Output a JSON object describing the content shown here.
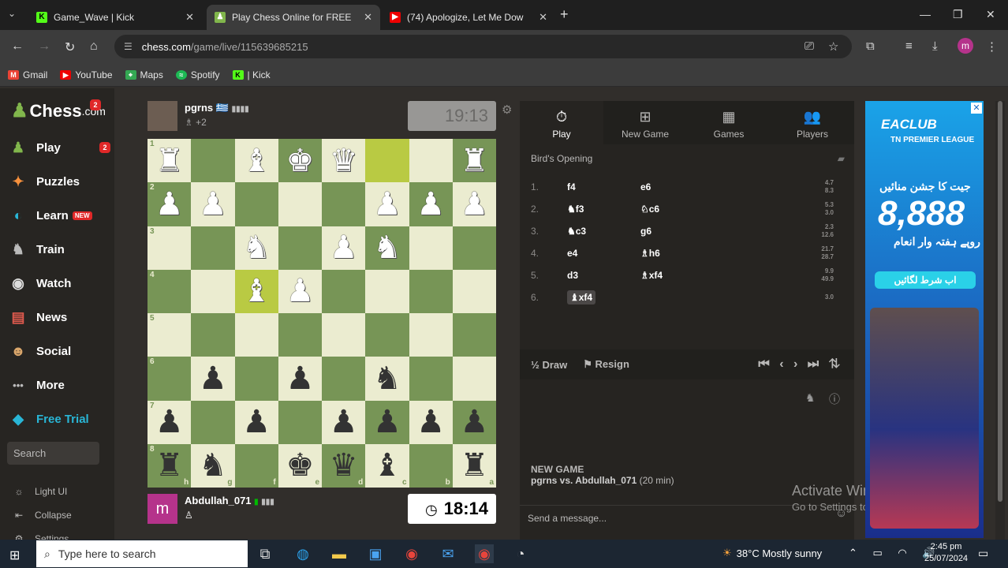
{
  "browser": {
    "tabs": [
      {
        "title": "Game_Wave | Kick",
        "icon": "K"
      },
      {
        "title": "Play Chess Online for FREE",
        "icon": "♟"
      },
      {
        "title": "(74) Apologize, Let Me Dow",
        "icon": "▶"
      }
    ],
    "url_host": "chess.com",
    "url_path": "/game/live/115639685215",
    "bookmarks": [
      "Gmail",
      "YouTube",
      "Maps",
      "Spotify",
      "| Kick"
    ],
    "profile_initial": "m"
  },
  "sidebar": {
    "logo_text": "Chess",
    "logo_suffix": ".com",
    "logo_badge": "2",
    "items": [
      {
        "label": "Play",
        "icon": "♟",
        "badge": "2"
      },
      {
        "label": "Puzzles",
        "icon": "✦"
      },
      {
        "label": "Learn",
        "icon": "◐",
        "tag": "NEW"
      },
      {
        "label": "Train",
        "icon": "♞"
      },
      {
        "label": "Watch",
        "icon": "◉"
      },
      {
        "label": "News",
        "icon": "▤"
      },
      {
        "label": "Social",
        "icon": "☻"
      },
      {
        "label": "More",
        "icon": "•••"
      },
      {
        "label": "Free Trial",
        "icon": "◆"
      }
    ],
    "search_placeholder": "Search",
    "footer": [
      {
        "label": "Light UI",
        "icon": "☼"
      },
      {
        "label": "Collapse",
        "icon": "⇤"
      },
      {
        "label": "Settings",
        "icon": "⚙"
      }
    ]
  },
  "game": {
    "top_player": {
      "name": "pgrns",
      "flag": "🇬🇷",
      "captured": "♗ +2",
      "clock": "19:13"
    },
    "bottom_player": {
      "name": "Abdullah_071",
      "avatar": "m",
      "captured": "♙",
      "clock": "18:14"
    },
    "board_rows": [
      [
        "wR",
        "",
        "wB",
        "wK",
        "wQ",
        "",
        "",
        "wR"
      ],
      [
        "wP",
        "wP",
        "",
        "",
        "",
        "wP",
        "wP",
        "wP"
      ],
      [
        "",
        "",
        "wN",
        "",
        "wP",
        "wN",
        "",
        ""
      ],
      [
        "",
        "",
        "wB",
        "wP",
        "",
        "",
        "",
        ""
      ],
      [
        "",
        "",
        "",
        "",
        "",
        "",
        "",
        ""
      ],
      [
        "",
        "bP",
        "",
        "bP",
        "",
        "bN",
        "",
        ""
      ],
      [
        "bP",
        "",
        "bP",
        "",
        "bP",
        "bP",
        "bP",
        "bP"
      ],
      [
        "bR",
        "bN",
        "",
        "bK",
        "bQ",
        "bB",
        "",
        "bR"
      ]
    ],
    "rank_labels": [
      "1",
      "2",
      "3",
      "4",
      "5",
      "6",
      "7",
      "8"
    ],
    "file_labels": [
      "h",
      "g",
      "f",
      "e",
      "d",
      "c",
      "b",
      "a"
    ]
  },
  "panel": {
    "tabs": [
      {
        "label": "Play",
        "icon": "⏱"
      },
      {
        "label": "New Game",
        "icon": "⊞"
      },
      {
        "label": "Games",
        "icon": "▦"
      },
      {
        "label": "Players",
        "icon": "👥"
      }
    ],
    "opening": "Bird's Opening",
    "moves": [
      {
        "num": "1.",
        "white": "f4",
        "black": "e6",
        "t1": "4.7",
        "t2": "8.3"
      },
      {
        "num": "2.",
        "white": "♞f3",
        "black": "♘c6",
        "t1": "5.3",
        "t2": "3.0"
      },
      {
        "num": "3.",
        "white": "♞c3",
        "black": "g6",
        "t1": "2.3",
        "t2": "12.6"
      },
      {
        "num": "4.",
        "white": "e4",
        "black": "♗h6",
        "t1": "21.7",
        "t2": "28.7"
      },
      {
        "num": "5.",
        "white": "d3",
        "black": "♗xf4",
        "t1": "9.9",
        "t2": "49.9"
      },
      {
        "num": "6.",
        "white": "♝xf4",
        "black": "",
        "t1": "3.0",
        "t2": ""
      }
    ],
    "draw_label": "Draw",
    "resign_label": "Resign",
    "nav_arrows": "⏮ ‹ › ⏭ ⇅",
    "new_game_title": "NEW GAME",
    "new_game_players": "pgrns vs. Abdullah_071",
    "new_game_time": "(20 min)",
    "chat_placeholder": "Send a message...",
    "watermark_1": "Activate Windows",
    "watermark_2": "Go to Settings to activate Windows."
  },
  "ad": {
    "brand": "EACLUB",
    "league": "TN PREMIER LEAGUE",
    "line1": "جیت کا جشن منائیں",
    "amount": "8,888",
    "line2": "روپے ہفتہ وار انعام",
    "button": "اب شرط لگائیں"
  },
  "taskbar": {
    "search_placeholder": "Type here to search",
    "weather": "38°C  Mostly sunny",
    "time": "2:45 pm",
    "date": "25/07/2024"
  }
}
